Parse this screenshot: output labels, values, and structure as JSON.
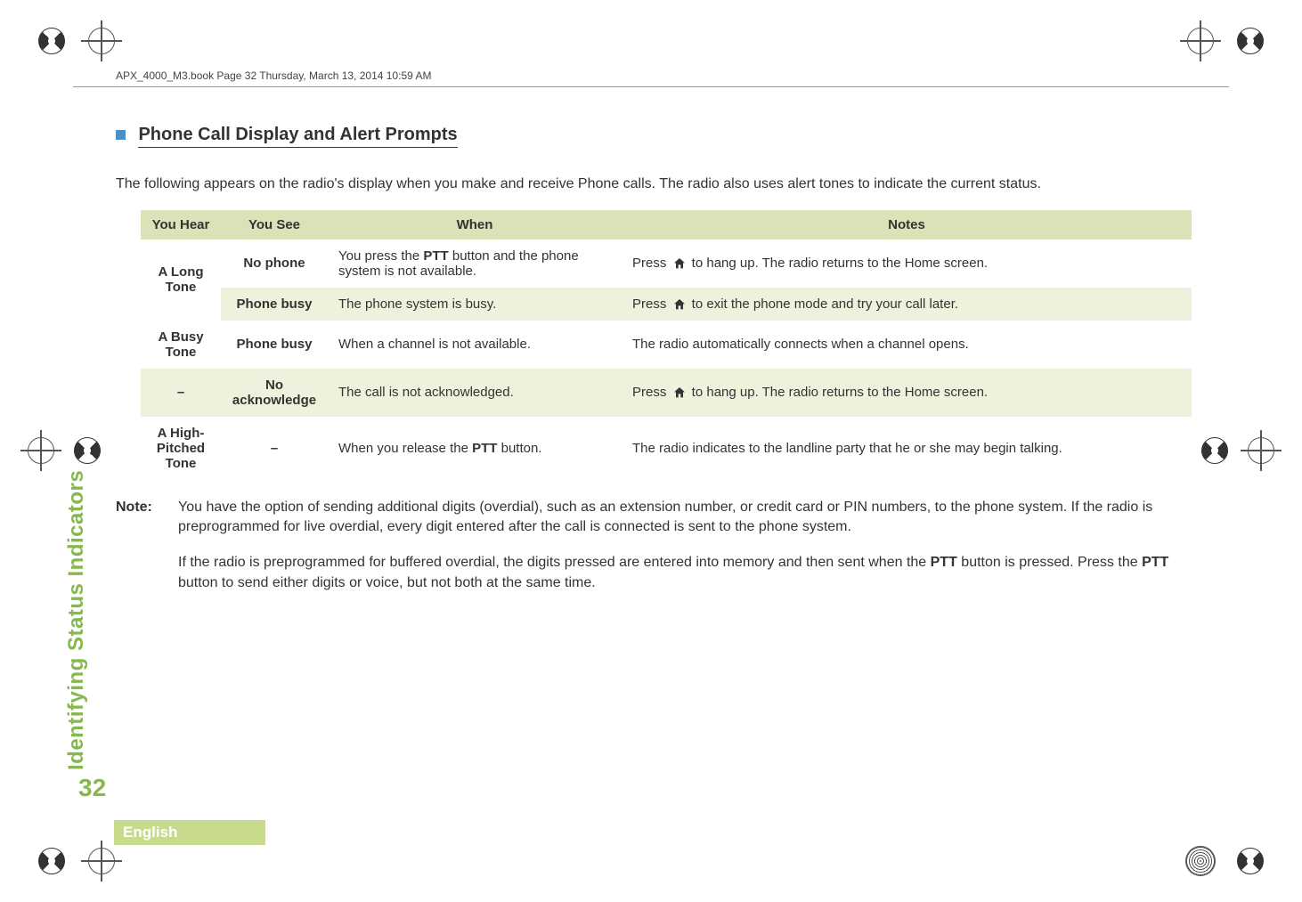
{
  "header": {
    "running_head": "APX_4000_M3.book  Page 32  Thursday, March 13, 2014  10:59 AM"
  },
  "section": {
    "title": "Phone Call Display and Alert Prompts",
    "intro": "The following appears on the radio's display when you make and receive Phone calls. The radio also uses alert tones to indicate the current status."
  },
  "table": {
    "headers": {
      "hear": "You Hear",
      "see": "You See",
      "when": "When",
      "notes": "Notes"
    },
    "rows": [
      {
        "hear": "A Long Tone",
        "see": "No phone",
        "when_pre": "You press the ",
        "when_bold": "PTT",
        "when_post": " button and the phone system is not available.",
        "notes_pre": "Press ",
        "notes_post": " to hang up. The radio returns to the Home screen.",
        "show_icon": true,
        "merge_hear": 2
      },
      {
        "hear": "",
        "see": "Phone busy",
        "when_pre": "The phone system is busy.",
        "when_bold": "",
        "when_post": "",
        "notes_pre": "Press ",
        "notes_post": " to exit the phone mode and try your call later.",
        "show_icon": true,
        "merge_hear": 0
      },
      {
        "hear": "A Busy Tone",
        "see": "Phone busy",
        "when_pre": "When a channel is not available.",
        "when_bold": "",
        "when_post": "",
        "notes_pre": "The radio automatically connects when a channel opens.",
        "notes_post": "",
        "show_icon": false,
        "merge_hear": 1
      },
      {
        "hear": "–",
        "see": "No acknowledge",
        "when_pre": "The call is not acknowledged.",
        "when_bold": "",
        "when_post": "",
        "notes_pre": "Press ",
        "notes_post": " to hang up. The radio returns to the Home screen.",
        "show_icon": true,
        "merge_hear": 1
      },
      {
        "hear": "A High-Pitched Tone",
        "see": "–",
        "when_pre": "When you release the ",
        "when_bold": "PTT",
        "when_post": " button.",
        "notes_pre": "The radio indicates to the landline party that he or she may begin talking.",
        "notes_post": "",
        "show_icon": false,
        "merge_hear": 1
      }
    ]
  },
  "note": {
    "label": "Note:",
    "p1_pre": "You have the option of sending additional digits (overdial), such as an extension number, or credit card or PIN numbers, to the phone system. If the radio is preprogrammed for live overdial, every digit entered after the call is connected is sent to the phone system.",
    "p2_a": "If the radio is preprogrammed for buffered overdial, the digits pressed are entered into memory and then sent when the ",
    "p2_b": "PTT",
    "p2_c": " button is pressed. Press the ",
    "p2_d": "PTT",
    "p2_e": " button to send either digits or voice, but not both at the same time."
  },
  "side": {
    "label": "Identifying Status Indicators"
  },
  "page": {
    "number": "32",
    "language": "English"
  }
}
